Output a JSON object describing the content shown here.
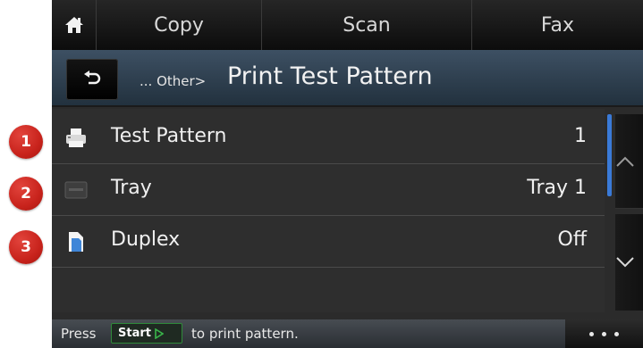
{
  "callouts": [
    "1",
    "2",
    "3"
  ],
  "tabs": {
    "home_icon": "home-icon",
    "copy": "Copy",
    "scan": "Scan",
    "fax": "Fax"
  },
  "header": {
    "back_icon": "back-arrow-icon",
    "breadcrumb_prefix": "... Other>",
    "title": "Print Test Pattern"
  },
  "rows": [
    {
      "icon": "printer-icon",
      "label": "Test Pattern",
      "value": "1"
    },
    {
      "icon": "tray-icon",
      "label": "Tray",
      "value": "Tray 1"
    },
    {
      "icon": "duplex-icon",
      "label": "Duplex",
      "value": "Off"
    }
  ],
  "status": {
    "press": "Press",
    "start_label": "Start",
    "rest": "to print pattern."
  },
  "colors": {
    "title_bar": "#2f4152",
    "scroll_indicator": "#3a7ad8",
    "start_badge_border": "#2f8a3a",
    "callout": "#c8231c"
  }
}
